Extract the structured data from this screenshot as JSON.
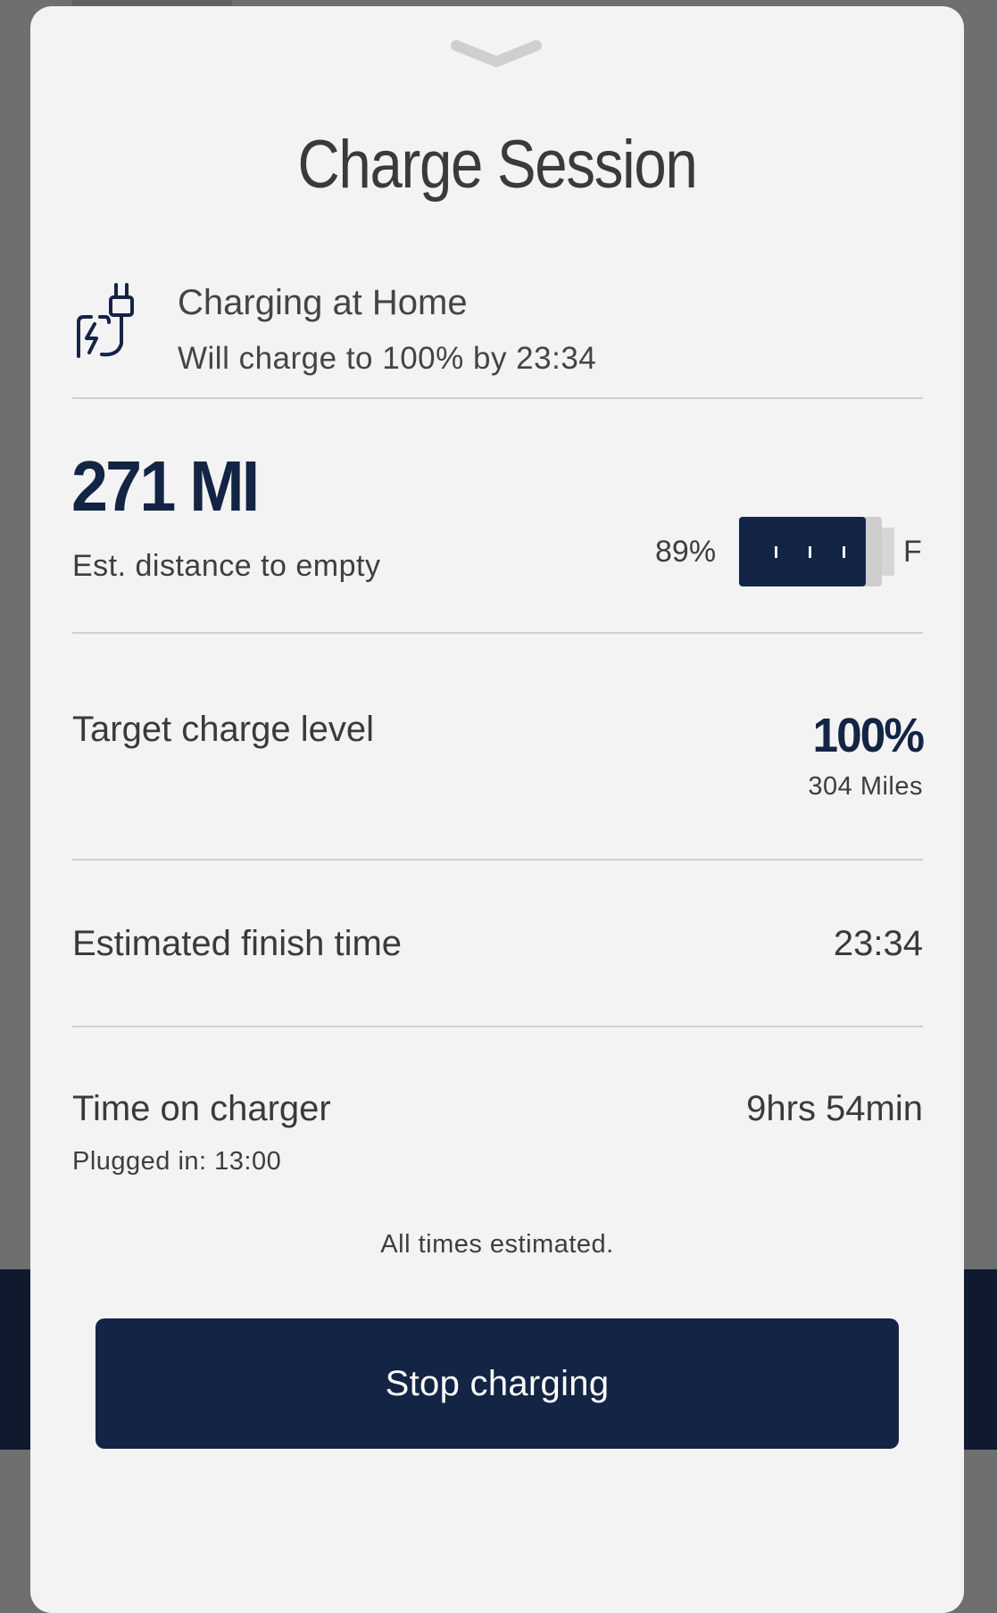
{
  "sheet": {
    "title": "Charge Session"
  },
  "charging_location": {
    "icon": "plug-charging-icon",
    "title": "Charging at Home",
    "subtitle": "Will charge to 100% by 23:34"
  },
  "range": {
    "value": "271 MI",
    "label": "Est. distance to empty"
  },
  "battery": {
    "percent_label": "89%",
    "level": 0.89,
    "full_label": "F"
  },
  "target_charge": {
    "label": "Target charge level",
    "value": "100%",
    "miles": "304 Miles"
  },
  "finish_time": {
    "label": "Estimated finish time",
    "value": "23:34"
  },
  "time_on_charger": {
    "label": "Time on charger",
    "value": "9hrs 54min",
    "plugged_in": "Plugged in: 13:00"
  },
  "disclaimer": "All times estimated.",
  "actions": {
    "stop_label": "Stop charging"
  },
  "colors": {
    "brand_navy": "#132445",
    "sheet_background": "#f3f3f3",
    "overlay": "#6f6f6f"
  }
}
